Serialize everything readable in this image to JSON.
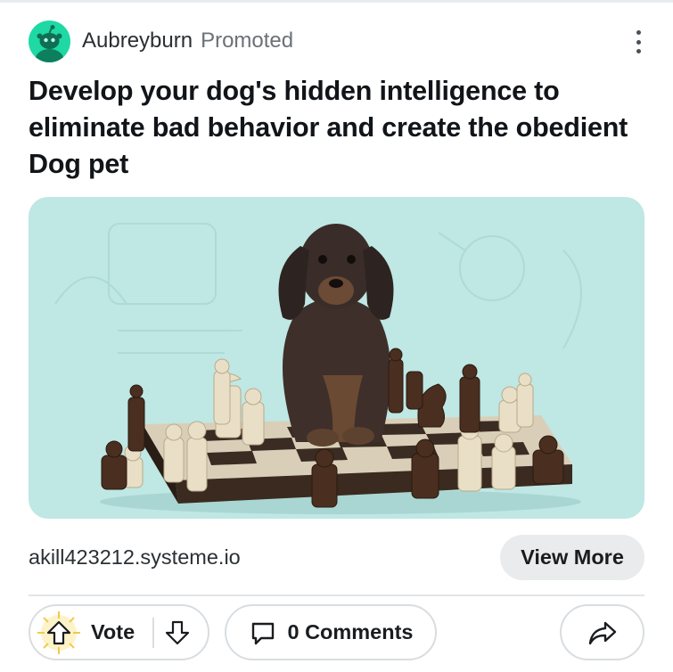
{
  "post": {
    "author": "Aubreyburn",
    "promoted_label": "Promoted",
    "title": "Develop your dog's hidden intelligence to eliminate bad behavior and create the obedient Dog pet",
    "domain": "akill423212.systeme.io",
    "cta_label": "View More",
    "avatar_icon": "reddit-alien-icon",
    "avatar_color": "#1ed9a4",
    "media_background": "#bfe7e4"
  },
  "actions": {
    "vote_label": "Vote",
    "comments_label": "0 Comments",
    "upvote_icon": "upvote-arrow-icon",
    "downvote_icon": "downvote-arrow-icon",
    "comment_icon": "speech-bubble-icon",
    "share_icon": "share-arrow-icon",
    "more_icon": "vertical-ellipsis-icon"
  }
}
